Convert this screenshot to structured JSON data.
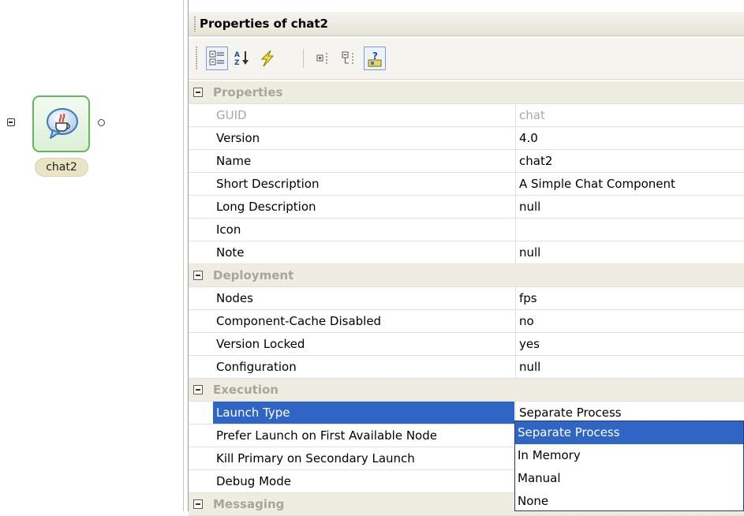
{
  "canvas": {
    "component_label": "chat2"
  },
  "panel": {
    "title": "Properties of chat2",
    "toolbar": {
      "buttons": [
        "show-categories-icon",
        "sort-alphabetically-icon",
        "event-lightning-icon",
        "expand-icon",
        "collapse-icon",
        "help-icon"
      ]
    },
    "groups": [
      {
        "name": "Properties",
        "rows": [
          {
            "name": "GUID",
            "value": "chat",
            "disabled": true
          },
          {
            "name": "Version",
            "value": "4.0"
          },
          {
            "name": "Name",
            "value": "chat2"
          },
          {
            "name": "Short Description",
            "value": "A Simple Chat Component"
          },
          {
            "name": "Long Description",
            "value": "null"
          },
          {
            "name": "Icon",
            "value": ""
          },
          {
            "name": "Note",
            "value": "null"
          }
        ]
      },
      {
        "name": "Deployment",
        "rows": [
          {
            "name": "Nodes",
            "value": "fps"
          },
          {
            "name": "Component-Cache Disabled",
            "value": "no"
          },
          {
            "name": "Version Locked",
            "value": "yes"
          },
          {
            "name": "Configuration",
            "value": "null"
          }
        ]
      },
      {
        "name": "Execution",
        "rows": [
          {
            "name": "Launch Type",
            "value": "Separate Process",
            "selected": true
          },
          {
            "name": "Prefer Launch on First Available Node",
            "value": ""
          },
          {
            "name": "Kill Primary on Secondary Launch",
            "value": ""
          },
          {
            "name": "Debug Mode",
            "value": ""
          }
        ]
      },
      {
        "name": "Messaging",
        "rows": []
      }
    ],
    "dropdown": {
      "options": [
        "Separate Process",
        "In Memory",
        "Manual",
        "None"
      ],
      "selected": "Separate Process"
    }
  },
  "colors": {
    "selection": "#2f65c4",
    "category_bg": "#efede2",
    "component_border": "#62b85a",
    "label_pill": "#e8e4c4"
  }
}
